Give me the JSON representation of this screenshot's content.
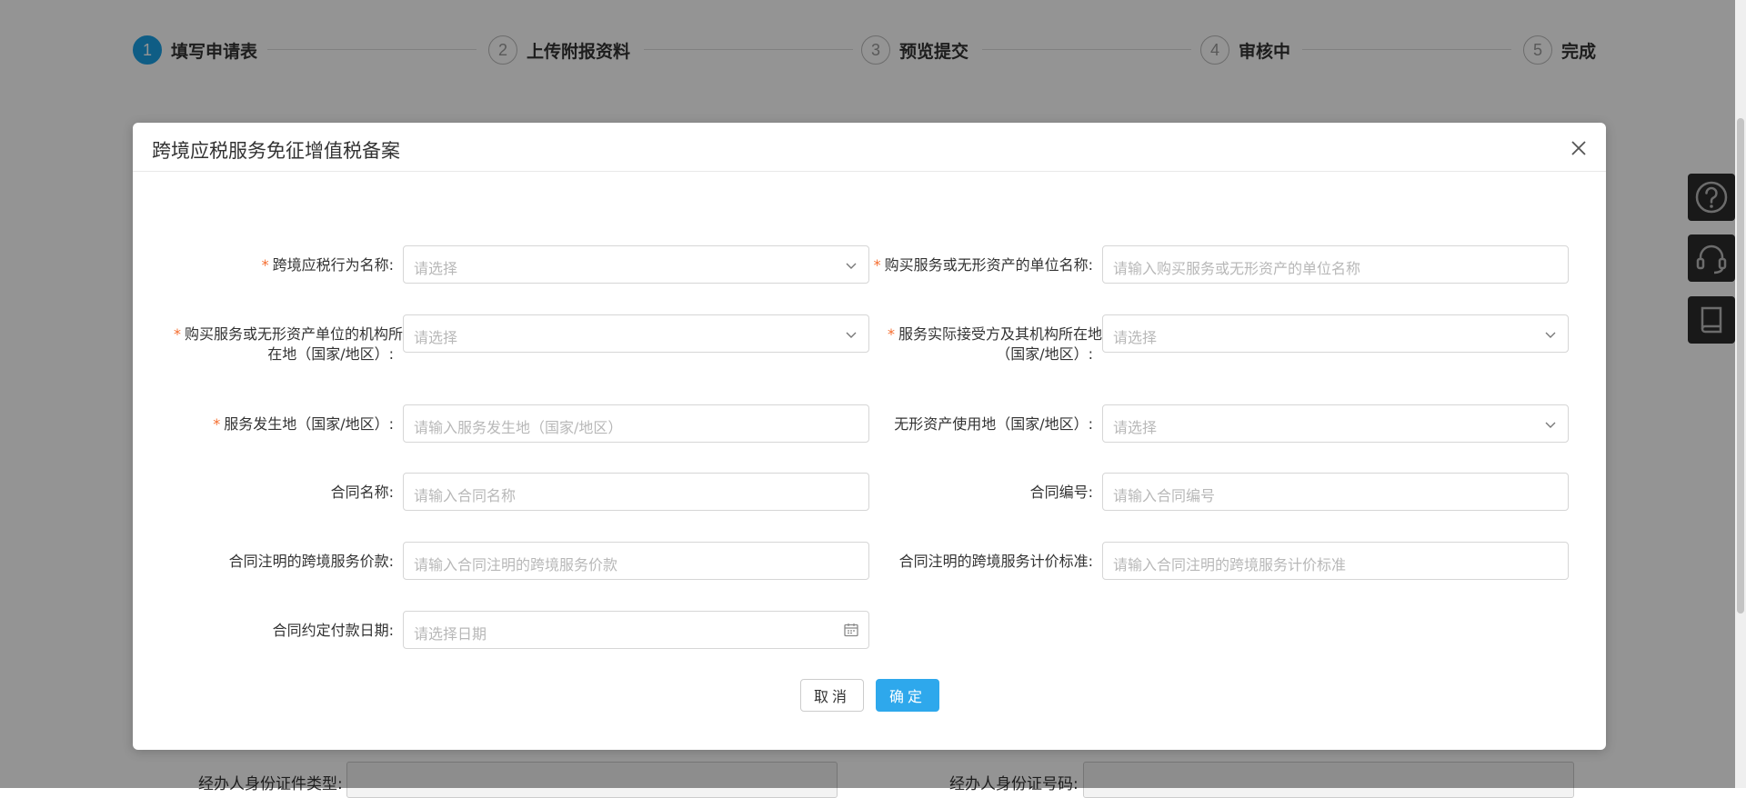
{
  "steps": [
    {
      "num": "1",
      "label": "填写申请表"
    },
    {
      "num": "2",
      "label": "上传附报资料"
    },
    {
      "num": "3",
      "label": "预览提交"
    },
    {
      "num": "4",
      "label": "审核中"
    },
    {
      "num": "5",
      "label": "完成"
    }
  ],
  "background_fields": {
    "id_type_label": "经办人身份证件类型:",
    "id_number_label": "经办人身份证号码:"
  },
  "modal": {
    "title": "跨境应税服务免征增值税备案",
    "fields": {
      "behavior_name": {
        "label": "跨境应税行为名称:",
        "placeholder": "请选择"
      },
      "buyer_name": {
        "label": "购买服务或无形资产的单位名称:",
        "placeholder": "请输入购买服务或无形资产的单位名称"
      },
      "buyer_location": {
        "label_line1": "购买服务或无形资产单位的机构所",
        "label_line2": "在地（国家/地区）:",
        "placeholder": "请选择"
      },
      "receiver_location": {
        "label_line1": "服务实际接受方及其机构所在地",
        "label_line2": "（国家/地区）:",
        "placeholder": "请选择"
      },
      "service_place": {
        "label": "服务发生地（国家/地区）:",
        "placeholder": "请输入服务发生地（国家/地区）"
      },
      "asset_use_place": {
        "label": "无形资产使用地（国家/地区）:",
        "placeholder": "请选择"
      },
      "contract_name": {
        "label": "合同名称:",
        "placeholder": "请输入合同名称"
      },
      "contract_no": {
        "label": "合同编号:",
        "placeholder": "请输入合同编号"
      },
      "contract_price": {
        "label": "合同注明的跨境服务价款:",
        "placeholder": "请输入合同注明的跨境服务价款"
      },
      "contract_pricing_std": {
        "label": "合同注明的跨境服务计价标准:",
        "placeholder": "请输入合同注明的跨境服务计价标准"
      },
      "payment_date": {
        "label": "合同约定付款日期:",
        "placeholder": "请选择日期"
      }
    },
    "required_mark": "*",
    "cancel_label": "取消",
    "ok_label": "确定"
  },
  "icons": {
    "help": "help-icon",
    "support": "headset-icon",
    "manual": "book-icon",
    "close": "close-icon"
  },
  "colors": {
    "accent": "#2ea8ec",
    "required": "#f56c2d"
  }
}
